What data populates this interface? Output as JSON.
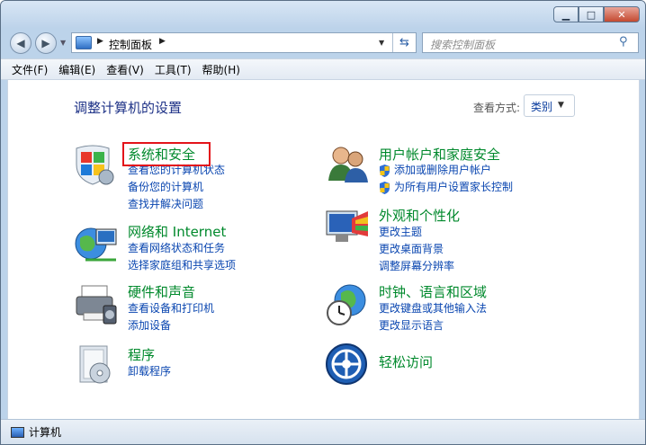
{
  "window": {
    "minimize_label": "▁",
    "maximize_label": "□",
    "close_label": "✕"
  },
  "address_bar": {
    "crumb": "控制面板",
    "search_placeholder": "搜索控制面板"
  },
  "menu": [
    "文件(F)",
    "编辑(E)",
    "查看(V)",
    "工具(T)",
    "帮助(H)"
  ],
  "content": {
    "heading": "调整计算机的设置",
    "view_by_label": "查看方式:",
    "view_by_value": "类别"
  },
  "categories": {
    "system": {
      "title": "系统和安全",
      "links": [
        "查看您的计算机状态",
        "备份您的计算机",
        "查找并解决问题"
      ]
    },
    "network": {
      "title": "网络和 Internet",
      "links": [
        "查看网络状态和任务",
        "选择家庭组和共享选项"
      ]
    },
    "hardware": {
      "title": "硬件和声音",
      "links": [
        "查看设备和打印机",
        "添加设备"
      ]
    },
    "programs": {
      "title": "程序",
      "links": [
        "卸载程序"
      ]
    },
    "users": {
      "title": "用户帐户和家庭安全",
      "links": [
        "添加或删除用户帐户",
        "为所有用户设置家长控制"
      ]
    },
    "appearance": {
      "title": "外观和个性化",
      "links": [
        "更改主题",
        "更改桌面背景",
        "调整屏幕分辨率"
      ]
    },
    "clock": {
      "title": "时钟、语言和区域",
      "links": [
        "更改键盘或其他输入法",
        "更改显示语言"
      ]
    },
    "access": {
      "title": "轻松访问",
      "links": []
    }
  },
  "status": {
    "label": "计算机"
  },
  "colors": {
    "category_title": "#00892c",
    "link": "#0a46b0",
    "heading": "#1e3287",
    "highlight_box": "#e3131a"
  }
}
